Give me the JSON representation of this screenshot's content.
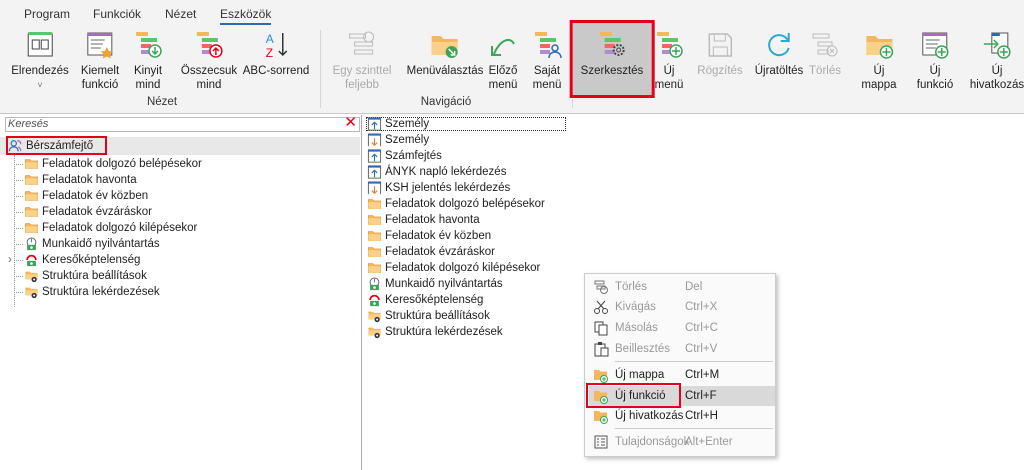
{
  "tabs": [
    {
      "label": "Program"
    },
    {
      "label": "Funkciók"
    },
    {
      "label": "Nézet"
    },
    {
      "label": "Eszközök",
      "active": true
    }
  ],
  "ribbon": {
    "buttons": [
      {
        "l1": "Elrendezés",
        "l2": "˅",
        "icon": "layout-icon"
      },
      {
        "l1": "Kiemelt",
        "l2": "funkció",
        "icon": "starred-function-icon"
      },
      {
        "l1": "Kinyit",
        "l2": "mind",
        "icon": "expand-all-icon"
      },
      {
        "l1": "Összecsuk",
        "l2": "mind",
        "icon": "collapse-all-icon"
      },
      {
        "l1": "ABC-sorrend",
        "l2": "",
        "icon": "sort-az-icon"
      },
      {
        "l1": "Egy szinttel",
        "l2": "feljebb",
        "icon": "level-up-icon",
        "disabled": true
      },
      {
        "l1": "Menüválasztás",
        "l2": "",
        "icon": "menu-select-folder-icon"
      },
      {
        "l1": "Előző",
        "l2": "menü",
        "icon": "back-arrow-icon"
      },
      {
        "l1": "Saját",
        "l2": "menü",
        "icon": "own-menu-icon"
      },
      {
        "l1": "Szerkesztés",
        "l2": "",
        "icon": "edit-gear-icon",
        "selected": true
      },
      {
        "l1": "Új",
        "l2": "menü",
        "icon": "new-menu-icon"
      },
      {
        "l1": "Rögzítés",
        "l2": "",
        "icon": "save-icon",
        "disabled": true
      },
      {
        "l1": "Újratöltés",
        "l2": "",
        "icon": "reload-icon"
      },
      {
        "l1": "Törlés",
        "l2": "",
        "icon": "delete-icon",
        "disabled": true
      },
      {
        "l1": "Új",
        "l2": "mappa",
        "icon": "new-folder-icon"
      },
      {
        "l1": "Új",
        "l2": "funkció",
        "icon": "new-function-icon"
      },
      {
        "l1": "Új",
        "l2": "hivatkozás",
        "icon": "new-link-icon"
      }
    ],
    "groups": [
      {
        "label": "Nézet"
      },
      {
        "label": "Navigáció"
      }
    ]
  },
  "search": {
    "placeholder": "Keresés"
  },
  "tree": {
    "root": "Bérszámfejtő",
    "items": [
      {
        "label": "Feladatok dolgozó belépésekor",
        "icon": "folder"
      },
      {
        "label": "Feladatok havonta",
        "icon": "folder"
      },
      {
        "label": "Feladatok év közben",
        "icon": "folder"
      },
      {
        "label": "Feladatok évzáráskor",
        "icon": "folder"
      },
      {
        "label": "Feladatok dolgozó kilépésekor",
        "icon": "folder"
      },
      {
        "label": "Munkaidő nyilvántartás",
        "icon": "clock-money"
      },
      {
        "label": "Keresőképtelenség",
        "icon": "sick-money",
        "expandable": true
      },
      {
        "label": "Struktúra beállítások",
        "icon": "folder-gear"
      },
      {
        "label": "Struktúra lekérdezések",
        "icon": "folder-gear"
      }
    ]
  },
  "list": {
    "items": [
      {
        "label": "Személy",
        "icon": "import-up"
      },
      {
        "label": "Személy",
        "icon": "export-down"
      },
      {
        "label": "Számfejtés",
        "icon": "import-up"
      },
      {
        "label": "ÁNYK napló lekérdezés",
        "icon": "import-up"
      },
      {
        "label": "KSH jelentés lekérdezés",
        "icon": "export-down"
      },
      {
        "label": "Feladatok dolgozó belépésekor",
        "icon": "folder"
      },
      {
        "label": "Feladatok havonta",
        "icon": "folder"
      },
      {
        "label": "Feladatok év közben",
        "icon": "folder"
      },
      {
        "label": "Feladatok évzáráskor",
        "icon": "folder"
      },
      {
        "label": "Feladatok dolgozó kilépésekor",
        "icon": "folder"
      },
      {
        "label": "Munkaidő nyilvántartás",
        "icon": "clock-money"
      },
      {
        "label": "Keresőképtelenség",
        "icon": "sick-money"
      },
      {
        "label": "Struktúra beállítások",
        "icon": "folder-gear"
      },
      {
        "label": "Struktúra lekérdezések",
        "icon": "folder-gear"
      }
    ]
  },
  "context_menu": {
    "items": [
      {
        "label": "Törlés",
        "shortcut": "Del",
        "icon": "delete-icon",
        "disabled": true
      },
      {
        "label": "Kivágás",
        "shortcut": "Ctrl+X",
        "icon": "scissors-icon",
        "disabled": true
      },
      {
        "label": "Másolás",
        "shortcut": "Ctrl+C",
        "icon": "copy-icon",
        "disabled": true
      },
      {
        "label": "Beillesztés",
        "shortcut": "Ctrl+V",
        "icon": "paste-icon",
        "disabled": true
      },
      {
        "label": "Új mappa",
        "shortcut": "Ctrl+M",
        "icon": "new-folder-icon"
      },
      {
        "label": "Új funkció",
        "shortcut": "Ctrl+F",
        "icon": "new-function-icon",
        "highlighted": true
      },
      {
        "label": "Új hivatkozás",
        "shortcut": "Ctrl+H",
        "icon": "new-link-icon"
      },
      {
        "label": "Tulajdonságok",
        "shortcut": "Alt+Enter",
        "icon": "properties-icon",
        "disabled": true
      }
    ]
  },
  "colors": {
    "highlight_box": "#e3001b",
    "folder": "#f5b660",
    "accent": "#2b6cb0"
  }
}
